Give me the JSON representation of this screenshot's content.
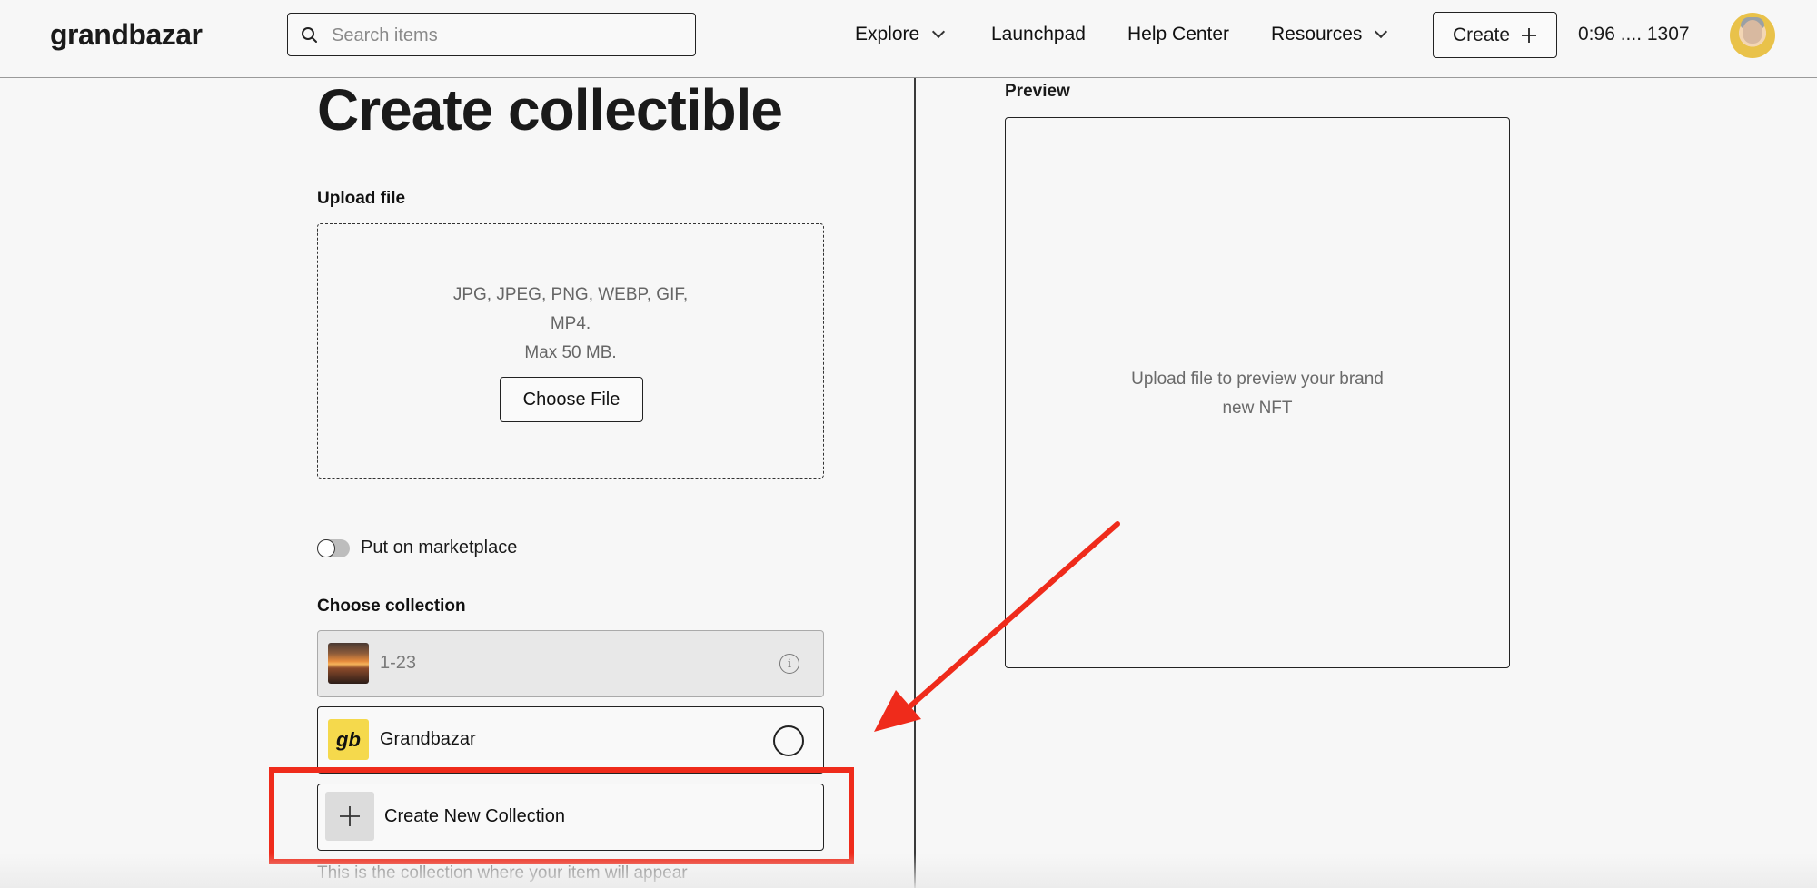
{
  "header": {
    "logo": "grandbazar",
    "search_placeholder": "Search items",
    "nav": {
      "explore": "Explore",
      "launchpad": "Launchpad",
      "help_center": "Help Center",
      "resources": "Resources"
    },
    "create_label": "Create",
    "wallet": "0:96 .... 1307"
  },
  "main": {
    "title": "Create collectible",
    "upload": {
      "label": "Upload file",
      "formats_line1": "JPG, JPEG, PNG, WEBP, GIF,",
      "formats_line2": "MP4.",
      "max_size": "Max 50 MB.",
      "choose_button": "Choose File"
    },
    "marketplace_toggle": {
      "label": "Put on marketplace",
      "on": false
    },
    "collection": {
      "label": "Choose collection",
      "items": [
        {
          "name": "1-23",
          "disabled": true,
          "icon": "info-icon"
        },
        {
          "name": "Grandbazar",
          "badge": "gb",
          "selected": false
        },
        {
          "name": "Create New Collection",
          "icon": "plus-icon"
        }
      ],
      "helper": "This is the collection where your item will appear"
    }
  },
  "preview": {
    "label": "Preview",
    "placeholder_line1": "Upload file to preview your brand",
    "placeholder_line2": "new NFT"
  },
  "annotation": {
    "color": "#ef2b1b"
  }
}
